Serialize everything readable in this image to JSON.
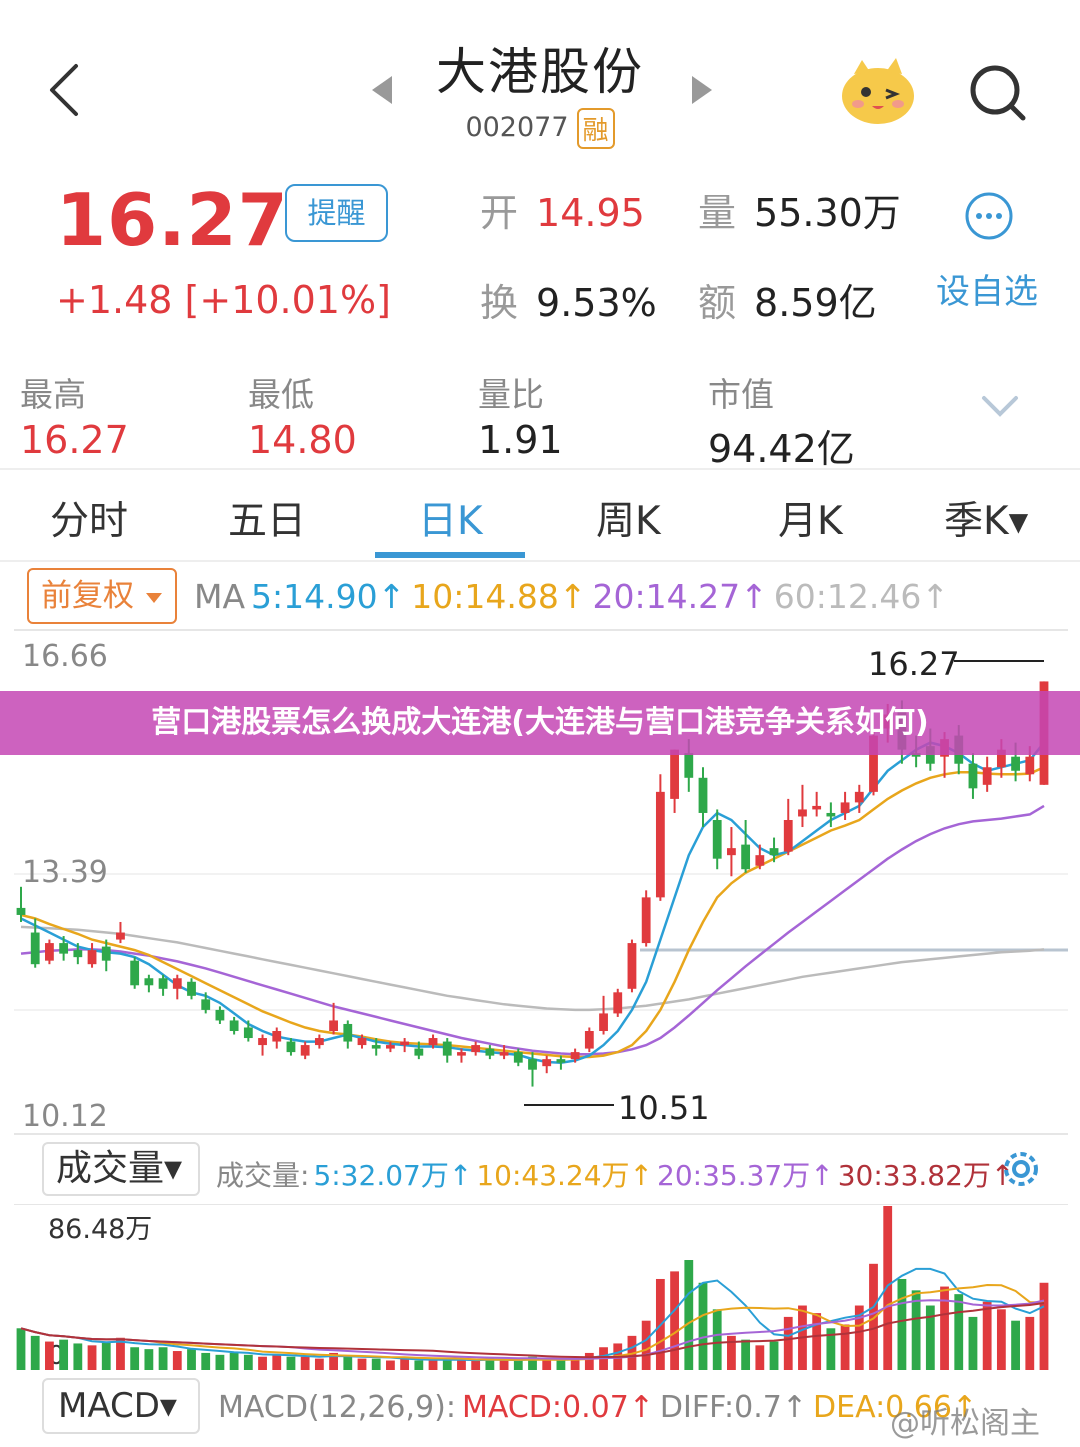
{
  "header": {
    "title": "大港股份",
    "code": "002077",
    "margin_badge": "融"
  },
  "quote": {
    "price": "16.27",
    "change": "+1.48 [+10.01%]",
    "remind_label": "提醒",
    "open_label": "开",
    "open_value": "14.95",
    "volume_label": "量",
    "volume_value": "55.30万",
    "turnover_label": "换",
    "turnover_value": "9.53%",
    "amount_label": "额",
    "amount_value": "8.59亿",
    "add_watchlist": "设自选"
  },
  "summary": [
    {
      "label": "最高",
      "value": "16.27",
      "color": "#e03a3e"
    },
    {
      "label": "最低",
      "value": "14.80",
      "color": "#e03a3e"
    },
    {
      "label": "量比",
      "value": "1.91",
      "color": "#222222"
    },
    {
      "label": "市值",
      "value": "94.42亿",
      "color": "#222222"
    }
  ],
  "tabs": [
    {
      "label": "分时",
      "active": false
    },
    {
      "label": "五日",
      "active": false
    },
    {
      "label": "日K",
      "active": true
    },
    {
      "label": "周K",
      "active": false
    },
    {
      "label": "月K",
      "active": false
    },
    {
      "label": "季K▾",
      "active": false
    }
  ],
  "ma": {
    "adjust_label": "前复权",
    "prefix": "MA",
    "ma5": "5:14.90↑",
    "ma10": "10:14.88↑",
    "ma20": "20:14.27↑",
    "ma60": "60:12.46↑",
    "colors": {
      "ma5": "#2a9fd6",
      "ma10": "#e8a61c",
      "ma20": "#a565d6",
      "ma60": "#bbbbbb"
    }
  },
  "kchart": {
    "y_top_label": "16.66",
    "y_mid_label": "13.39",
    "y_bottom_label": "10.12",
    "high_label": "16.27",
    "low_label": "10.51"
  },
  "banner": {
    "text": "营口港股票怎么换成大连港(大连港与营口港竞争关系如何)"
  },
  "volume": {
    "button_label": "成交量▾",
    "prefix": "成交量:",
    "ma5": "5:32.07万↑",
    "ma10": "10:43.24万↑",
    "ma20": "20:35.37万↑",
    "ma30": "30:33.82万↑",
    "max_label": "86.48万",
    "zero_label": "0"
  },
  "macd": {
    "button_label": "MACD▾",
    "params": "MACD(12,26,9):",
    "macd_value": "MACD:0.07↑",
    "diff_value": "DIFF:0.7↑",
    "dea_value": "DEA:0.66↑"
  },
  "watermark": "@听松阁主",
  "colors": {
    "up": "#e03a3e",
    "down": "#2ea84a",
    "accent": "#3a97d4"
  },
  "chart_data": {
    "type": "candlestick",
    "ylim": [
      10.12,
      16.66
    ],
    "candles": [
      {
        "o": 13.05,
        "c": 12.95,
        "h": 13.35,
        "l": 12.85
      },
      {
        "o": 12.7,
        "c": 12.25,
        "h": 12.9,
        "l": 12.2
      },
      {
        "o": 12.3,
        "c": 12.55,
        "h": 12.6,
        "l": 12.25
      },
      {
        "o": 12.55,
        "c": 12.4,
        "h": 12.65,
        "l": 12.3
      },
      {
        "o": 12.45,
        "c": 12.35,
        "h": 12.55,
        "l": 12.25
      },
      {
        "o": 12.25,
        "c": 12.45,
        "h": 12.55,
        "l": 12.2
      },
      {
        "o": 12.5,
        "c": 12.3,
        "h": 12.6,
        "l": 12.15
      },
      {
        "o": 12.6,
        "c": 12.7,
        "h": 12.85,
        "l": 12.55
      },
      {
        "o": 12.3,
        "c": 11.95,
        "h": 12.35,
        "l": 11.9
      },
      {
        "o": 12.05,
        "c": 11.95,
        "h": 12.1,
        "l": 11.85
      },
      {
        "o": 12.05,
        "c": 11.9,
        "h": 12.1,
        "l": 11.8
      },
      {
        "o": 11.9,
        "c": 12.05,
        "h": 12.1,
        "l": 11.75
      },
      {
        "o": 12.0,
        "c": 11.8,
        "h": 12.05,
        "l": 11.75
      },
      {
        "o": 11.75,
        "c": 11.6,
        "h": 11.85,
        "l": 11.55
      },
      {
        "o": 11.6,
        "c": 11.45,
        "h": 11.65,
        "l": 11.4
      },
      {
        "o": 11.45,
        "c": 11.3,
        "h": 11.5,
        "l": 11.25
      },
      {
        "o": 11.35,
        "c": 11.2,
        "h": 11.45,
        "l": 11.15
      },
      {
        "o": 11.1,
        "c": 11.2,
        "h": 11.25,
        "l": 10.95
      },
      {
        "o": 11.15,
        "c": 11.3,
        "h": 11.35,
        "l": 11.05
      },
      {
        "o": 11.15,
        "c": 11.0,
        "h": 11.2,
        "l": 10.95
      },
      {
        "o": 10.95,
        "c": 11.1,
        "h": 11.15,
        "l": 10.9
      },
      {
        "o": 11.1,
        "c": 11.2,
        "h": 11.25,
        "l": 11.05
      },
      {
        "o": 11.3,
        "c": 11.45,
        "h": 11.7,
        "l": 11.25
      },
      {
        "o": 11.4,
        "c": 11.15,
        "h": 11.45,
        "l": 11.05
      },
      {
        "o": 11.1,
        "c": 11.2,
        "h": 11.25,
        "l": 11.05
      },
      {
        "o": 11.1,
        "c": 11.05,
        "h": 11.2,
        "l": 10.95
      },
      {
        "o": 11.05,
        "c": 11.1,
        "h": 11.15,
        "l": 11.0
      },
      {
        "o": 11.1,
        "c": 11.15,
        "h": 11.2,
        "l": 11.0
      },
      {
        "o": 11.05,
        "c": 10.95,
        "h": 11.15,
        "l": 10.9
      },
      {
        "o": 11.1,
        "c": 11.2,
        "h": 11.25,
        "l": 11.05
      },
      {
        "o": 11.15,
        "c": 10.95,
        "h": 11.2,
        "l": 10.85
      },
      {
        "o": 10.95,
        "c": 11.0,
        "h": 11.05,
        "l": 10.85
      },
      {
        "o": 11.0,
        "c": 11.1,
        "h": 11.15,
        "l": 10.95
      },
      {
        "o": 11.05,
        "c": 10.95,
        "h": 11.1,
        "l": 10.9
      },
      {
        "o": 10.95,
        "c": 11.0,
        "h": 11.1,
        "l": 10.9
      },
      {
        "o": 11.0,
        "c": 10.85,
        "h": 11.05,
        "l": 10.8
      },
      {
        "o": 10.9,
        "c": 10.75,
        "h": 11.0,
        "l": 10.51
      },
      {
        "o": 10.8,
        "c": 10.9,
        "h": 10.95,
        "l": 10.7
      },
      {
        "o": 10.9,
        "c": 10.85,
        "h": 10.95,
        "l": 10.75
      },
      {
        "o": 10.9,
        "c": 11.0,
        "h": 11.05,
        "l": 10.85
      },
      {
        "o": 11.05,
        "c": 11.3,
        "h": 11.35,
        "l": 11.0
      },
      {
        "o": 11.3,
        "c": 11.55,
        "h": 11.8,
        "l": 11.25
      },
      {
        "o": 11.55,
        "c": 11.85,
        "h": 11.9,
        "l": 11.5
      },
      {
        "o": 11.9,
        "c": 12.55,
        "h": 12.6,
        "l": 11.85
      },
      {
        "o": 12.55,
        "c": 13.2,
        "h": 13.3,
        "l": 12.5
      },
      {
        "o": 13.2,
        "c": 14.7,
        "h": 14.95,
        "l": 13.15
      },
      {
        "o": 14.6,
        "c": 15.3,
        "h": 15.3,
        "l": 14.4
      },
      {
        "o": 15.25,
        "c": 14.9,
        "h": 15.45,
        "l": 14.7
      },
      {
        "o": 14.9,
        "c": 14.4,
        "h": 15.05,
        "l": 14.2
      },
      {
        "o": 14.3,
        "c": 13.75,
        "h": 14.45,
        "l": 13.6
      },
      {
        "o": 13.8,
        "c": 13.9,
        "h": 14.2,
        "l": 13.5
      },
      {
        "o": 13.95,
        "c": 13.6,
        "h": 14.3,
        "l": 13.55
      },
      {
        "o": 13.65,
        "c": 13.8,
        "h": 13.95,
        "l": 13.6
      },
      {
        "o": 13.9,
        "c": 13.8,
        "h": 14.05,
        "l": 13.7
      },
      {
        "o": 13.85,
        "c": 14.3,
        "h": 14.6,
        "l": 13.8
      },
      {
        "o": 14.35,
        "c": 14.45,
        "h": 14.8,
        "l": 14.2
      },
      {
        "o": 14.45,
        "c": 14.5,
        "h": 14.7,
        "l": 14.35
      },
      {
        "o": 14.4,
        "c": 14.35,
        "h": 14.55,
        "l": 14.2
      },
      {
        "o": 14.4,
        "c": 14.55,
        "h": 14.7,
        "l": 14.3
      },
      {
        "o": 14.55,
        "c": 14.7,
        "h": 14.8,
        "l": 14.4
      },
      {
        "o": 14.7,
        "c": 15.5,
        "h": 15.6,
        "l": 14.65
      },
      {
        "o": 15.6,
        "c": 15.8,
        "h": 15.95,
        "l": 15.4
      },
      {
        "o": 15.85,
        "c": 15.3,
        "h": 16.0,
        "l": 15.1
      },
      {
        "o": 15.25,
        "c": 15.2,
        "h": 15.5,
        "l": 15.05
      },
      {
        "o": 15.35,
        "c": 15.1,
        "h": 15.6,
        "l": 15.0
      },
      {
        "o": 15.2,
        "c": 15.45,
        "h": 15.55,
        "l": 14.9
      },
      {
        "o": 15.5,
        "c": 15.1,
        "h": 15.65,
        "l": 14.95
      },
      {
        "o": 15.1,
        "c": 14.75,
        "h": 15.25,
        "l": 14.6
      },
      {
        "o": 14.8,
        "c": 15.05,
        "h": 15.2,
        "l": 14.7
      },
      {
        "o": 15.05,
        "c": 15.3,
        "h": 15.45,
        "l": 14.9
      },
      {
        "o": 15.2,
        "c": 15.0,
        "h": 15.4,
        "l": 14.85
      },
      {
        "o": 14.95,
        "c": 15.2,
        "h": 15.35,
        "l": 14.85
      },
      {
        "o": 14.8,
        "c": 16.27,
        "h": 16.27,
        "l": 14.8
      }
    ],
    "ma5": [
      12.9,
      12.8,
      12.7,
      12.6,
      12.5,
      12.45,
      12.42,
      12.4,
      12.35,
      12.25,
      12.1,
      11.95,
      11.85,
      11.8,
      11.7,
      11.55,
      11.4,
      11.3,
      11.22,
      11.18,
      11.15,
      11.15,
      11.2,
      11.25,
      11.2,
      11.15,
      11.12,
      11.1,
      11.08,
      11.08,
      11.07,
      11.04,
      11.02,
      11.0,
      10.98,
      10.96,
      10.9,
      10.86,
      10.85,
      10.88,
      10.95,
      11.1,
      11.3,
      11.6,
      12.0,
      12.6,
      13.2,
      13.8,
      14.2,
      14.4,
      14.3,
      14.1,
      13.9,
      13.8,
      13.85,
      14.0,
      14.15,
      14.3,
      14.4,
      14.5,
      14.75,
      15.0,
      15.15,
      15.3,
      15.4,
      15.35,
      15.25,
      15.1,
      15.0,
      15.05,
      15.1,
      15.15,
      15.4
    ],
    "ma10": [
      12.95,
      12.9,
      12.82,
      12.75,
      12.68,
      12.6,
      12.55,
      12.5,
      12.45,
      12.38,
      12.28,
      12.18,
      12.08,
      11.98,
      11.88,
      11.78,
      11.68,
      11.58,
      11.5,
      11.42,
      11.35,
      11.3,
      11.27,
      11.25,
      11.22,
      11.18,
      11.15,
      11.13,
      11.12,
      11.11,
      11.1,
      11.08,
      11.06,
      11.04,
      11.02,
      11.0,
      10.98,
      10.96,
      10.94,
      10.93,
      10.93,
      10.95,
      11.0,
      11.1,
      11.3,
      11.6,
      12.0,
      12.45,
      12.85,
      13.2,
      13.4,
      13.55,
      13.65,
      13.75,
      13.85,
      13.95,
      14.05,
      14.15,
      14.22,
      14.3,
      14.45,
      14.6,
      14.72,
      14.82,
      14.9,
      14.95,
      14.98,
      14.98,
      14.96,
      14.95,
      14.95,
      14.96,
      15.05
    ],
    "ma20": [
      12.4,
      12.42,
      12.44,
      12.45,
      12.46,
      12.46,
      12.45,
      12.43,
      12.4,
      12.37,
      12.33,
      12.29,
      12.24,
      12.19,
      12.13,
      12.07,
      12.01,
      11.95,
      11.89,
      11.83,
      11.77,
      11.71,
      11.65,
      11.6,
      11.55,
      11.5,
      11.45,
      11.4,
      11.35,
      11.3,
      11.25,
      11.2,
      11.16,
      11.12,
      11.08,
      11.05,
      11.02,
      11.0,
      10.98,
      10.97,
      10.97,
      10.98,
      11.0,
      11.04,
      11.1,
      11.2,
      11.35,
      11.52,
      11.7,
      11.88,
      12.05,
      12.22,
      12.38,
      12.54,
      12.7,
      12.85,
      13.0,
      13.15,
      13.3,
      13.45,
      13.6,
      13.75,
      13.88,
      14.0,
      14.1,
      14.18,
      14.24,
      14.28,
      14.3,
      14.32,
      14.35,
      14.38,
      14.5
    ],
    "ma60": [
      12.78,
      12.77,
      12.76,
      12.75,
      12.74,
      12.72,
      12.7,
      12.68,
      12.65,
      12.62,
      12.59,
      12.56,
      12.52,
      12.48,
      12.44,
      12.4,
      12.36,
      12.32,
      12.28,
      12.24,
      12.2,
      12.16,
      12.12,
      12.08,
      12.04,
      12.0,
      11.96,
      11.92,
      11.88,
      11.84,
      11.8,
      11.77,
      11.74,
      11.71,
      11.68,
      11.66,
      11.64,
      11.62,
      11.61,
      11.6,
      11.6,
      11.61,
      11.62,
      11.64,
      11.66,
      11.69,
      11.72,
      11.75,
      11.79,
      11.83,
      11.87,
      11.91,
      11.95,
      11.99,
      12.03,
      12.07,
      12.1,
      12.13,
      12.16,
      12.19,
      12.22,
      12.25,
      12.28,
      12.3,
      12.32,
      12.34,
      12.36,
      12.38,
      12.4,
      12.42,
      12.43,
      12.44,
      12.46
    ],
    "volume": [
      22,
      18,
      15,
      16,
      14,
      13,
      15,
      17,
      12,
      11,
      12,
      10,
      11,
      9,
      8,
      9,
      8,
      7,
      8,
      7,
      7,
      6,
      9,
      7,
      6,
      6,
      5,
      6,
      5,
      5,
      6,
      5,
      5,
      6,
      5,
      5,
      7,
      5,
      5,
      6,
      9,
      12,
      14,
      18,
      26,
      48,
      52,
      58,
      46,
      32,
      18,
      16,
      13,
      15,
      28,
      34,
      30,
      22,
      24,
      34,
      56,
      86.48,
      48,
      42,
      34,
      44,
      40,
      28,
      36,
      32,
      26,
      28,
      46
    ],
    "volume_ylim": [
      0,
      86.48
    ]
  }
}
